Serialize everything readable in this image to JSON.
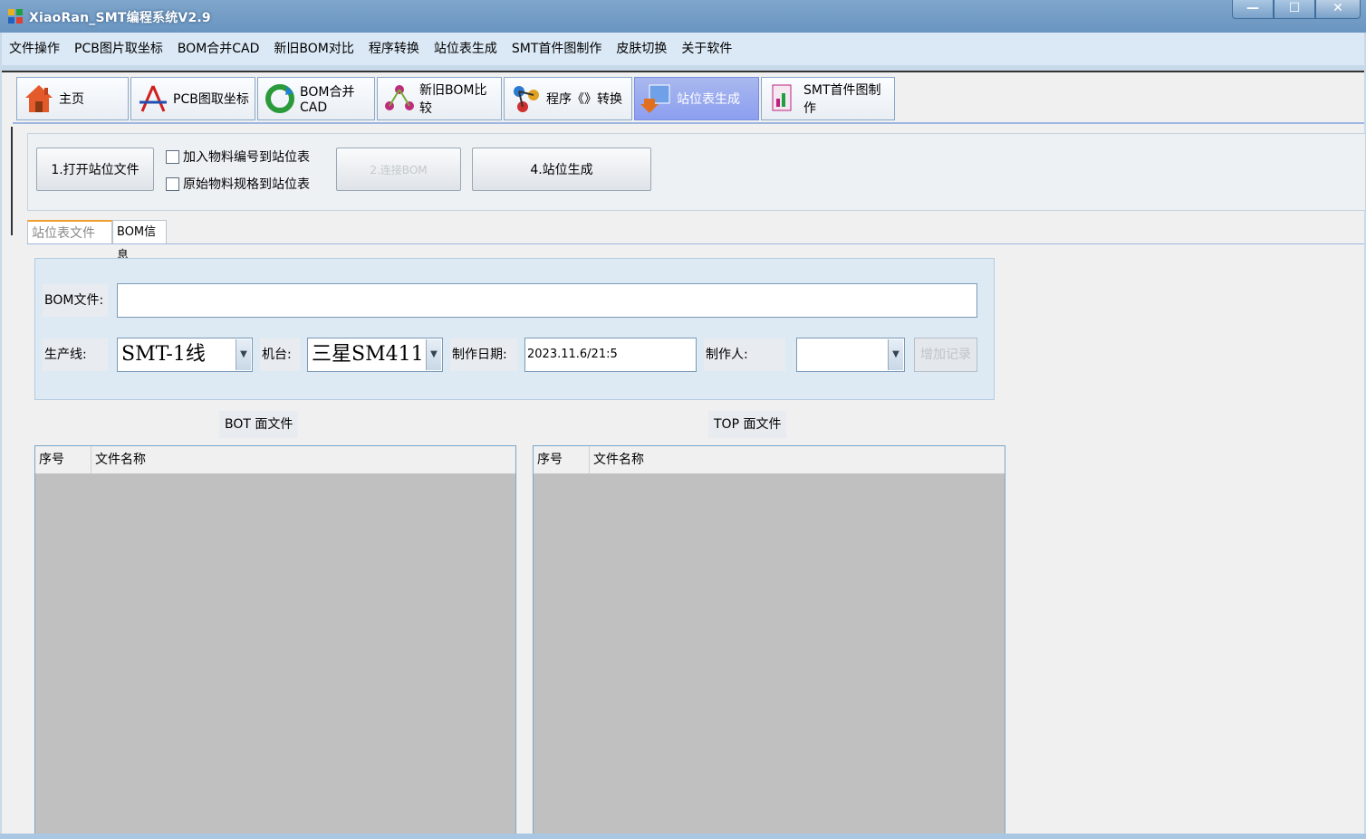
{
  "window": {
    "title": "XiaoRan_SMT编程系统V2.9",
    "min": "—",
    "max": "☐",
    "close": "✕"
  },
  "menu": [
    "文件操作",
    "PCB图片取坐标",
    "BOM合并CAD",
    "新旧BOM对比",
    "程序转换",
    "站位表生成",
    "SMT首件图制作",
    "皮肤切换",
    "关于软件"
  ],
  "tabs": [
    {
      "label": "主页",
      "icon": "home-icon"
    },
    {
      "label": "PCB图取坐标",
      "icon": "compass-icon"
    },
    {
      "label": "BOM合并CAD",
      "icon": "recycle-icon"
    },
    {
      "label": "新旧BOM比较",
      "icon": "network-icon"
    },
    {
      "label": "程序《》转换",
      "icon": "molecule-icon"
    },
    {
      "label": "站位表生成",
      "icon": "download-icon",
      "active": true
    },
    {
      "label": "SMT首件图制作",
      "icon": "document-chart-icon"
    }
  ],
  "toolbar": {
    "open_button": "1.打开站位文件",
    "check_add_code": "加入物料编号到站位表",
    "check_add_spec": "原始物料规格到站位表",
    "connect_bom": "2.连接BOM",
    "generate": "4.站位生成"
  },
  "subtabs": [
    "站位表文件",
    "BOM信息"
  ],
  "form": {
    "bom_label": "BOM文件:",
    "bom_value": "",
    "line_label": "生产线:",
    "line_value": "SMT-1线",
    "machine_label": "机台:",
    "machine_value": "三星SM411",
    "date_label": "制作日期:",
    "date_value": "2023.11.6/21:5",
    "maker_label": "制作人:",
    "maker_value": "",
    "add_record": "增加记录"
  },
  "lists": {
    "bot_caption": "BOT 面文件",
    "top_caption": "TOP 面文件",
    "col_index": "序号",
    "col_name": "文件名称"
  },
  "colors": {
    "active_tab": "#8c9ef0",
    "panel": "#dde9f3",
    "grid_body": "#c0c0c0"
  }
}
